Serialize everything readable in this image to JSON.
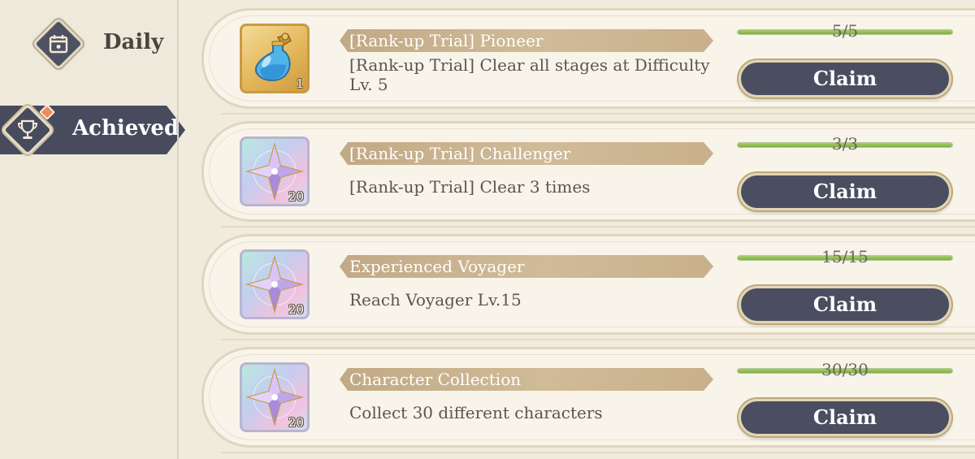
{
  "sidebar": {
    "tabs": [
      {
        "label": "Daily",
        "icon": "calendar-icon",
        "selected": false
      },
      {
        "label": "Achieved",
        "icon": "trophy-icon",
        "selected": true,
        "has_notification": true
      }
    ]
  },
  "achievements": [
    {
      "title": "[Rank-up Trial] Pioneer",
      "description": "[Rank-up Trial] Clear all stages at Difficulty Lv. 5",
      "reward_icon": "blue-potion-icon",
      "reward_qty": "1",
      "progress_text": "5/5",
      "progress_fraction": 1.0,
      "button_label": "Claim"
    },
    {
      "title": "[Rank-up Trial] Challenger",
      "description": "[Rank-up Trial] Clear 3 times",
      "reward_icon": "crystal-star-icon",
      "reward_qty": "20",
      "progress_text": "3/3",
      "progress_fraction": 1.0,
      "button_label": "Claim"
    },
    {
      "title": "Experienced Voyager",
      "description": "Reach Voyager Lv.15",
      "reward_icon": "crystal-star-icon",
      "reward_qty": "20",
      "progress_text": "15/15",
      "progress_fraction": 1.0,
      "button_label": "Claim"
    },
    {
      "title": "Character Collection",
      "description": "Collect 30 different characters",
      "reward_icon": "crystal-star-icon",
      "reward_qty": "20",
      "progress_text": "30/30",
      "progress_fraction": 1.0,
      "button_label": "Claim"
    }
  ],
  "colors": {
    "background": "#f1ebdd",
    "card": "#f8f4ea",
    "button": "#4a4e60",
    "ribbon": "#c7ae89",
    "progress": "#8fbe52",
    "selected_tab": "#474b5d"
  }
}
